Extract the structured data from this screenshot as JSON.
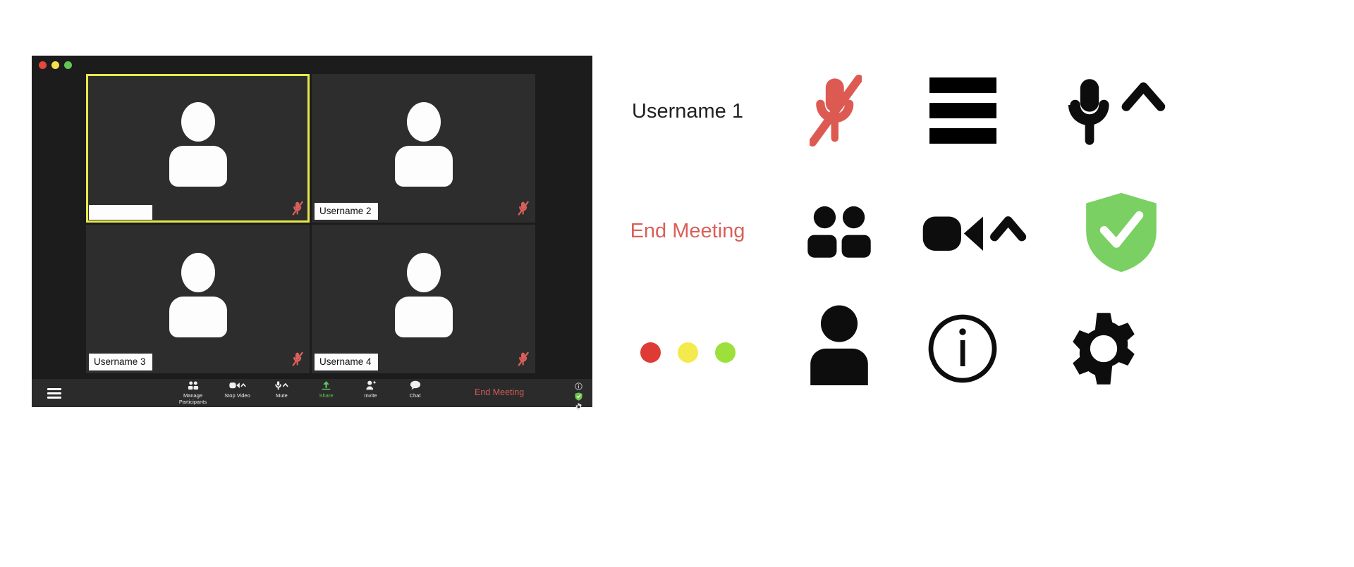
{
  "window": {
    "traffic_lights": [
      {
        "name": "close",
        "color": "#e8453c"
      },
      {
        "name": "minimize",
        "color": "#f4e04b"
      },
      {
        "name": "maximize",
        "color": "#62c554"
      }
    ]
  },
  "meeting": {
    "participants": [
      {
        "name": "",
        "active": true,
        "muted": true
      },
      {
        "name": "Username 2",
        "active": false,
        "muted": true
      },
      {
        "name": "Username 3",
        "active": false,
        "muted": true
      },
      {
        "name": "Username 4",
        "active": false,
        "muted": true
      }
    ],
    "active_speaker_border_color": "#e8e84a"
  },
  "toolbar": {
    "menu_icon": "hamburger-icon",
    "items": [
      {
        "icon": "participants-icon",
        "label": "Manage\nParticipants",
        "label_line1": "Manage",
        "label_line2": "Participants",
        "color": "#f0f0f0"
      },
      {
        "icon": "video-camera-icon",
        "label": "Stop Video",
        "label_line1": "Stop Video",
        "label_line2": "",
        "color": "#f0f0f0"
      },
      {
        "icon": "microphone-icon",
        "label": "Mute",
        "label_line1": "Mute",
        "label_line2": "",
        "color": "#f0f0f0"
      },
      {
        "icon": "share-screen-icon",
        "label": "Share",
        "label_line1": "Share",
        "label_line2": "",
        "color": "#5fc75f"
      },
      {
        "icon": "invite-person-icon",
        "label": "Invite",
        "label_line1": "Invite",
        "label_line2": "",
        "color": "#f0f0f0"
      },
      {
        "icon": "chat-bubble-icon",
        "label": "Chat",
        "label_line1": "Chat",
        "label_line2": "",
        "color": "#f0f0f0"
      }
    ],
    "end_meeting_label": "End Meeting",
    "end_meeting_color": "#cf5b54",
    "right_icons": [
      "info-circle-icon",
      "shield-check-icon",
      "gear-icon"
    ]
  },
  "legend": {
    "row1": {
      "username_label": "Username 1",
      "icon_mic_muted": "microphone-muted-icon",
      "icon_hamburger": "hamburger-menu-icon",
      "icon_mic_chevron": "microphone-chevron-up-icon"
    },
    "row2": {
      "end_meeting_label": "End Meeting",
      "icon_participants": "participants-group-icon",
      "icon_video_chevron": "video-camera-chevron-up-icon",
      "icon_shield": "shield-check-icon"
    },
    "row3": {
      "icon_traffic_lights": "traffic-light-dots-icon",
      "dots": [
        "#e03a34",
        "#f5ea4d",
        "#9de03c"
      ],
      "icon_person": "person-avatar-icon",
      "icon_info": "info-circle-icon",
      "icon_gear": "gear-icon"
    }
  },
  "colors": {
    "window_bg": "#1c1c1c",
    "tile_bg": "#2d2d2d",
    "toolbar_bg": "#2b2b2b",
    "accent_red": "#d9605a",
    "accent_green": "#6fc44d",
    "accent_yellow": "#e8e84a"
  }
}
